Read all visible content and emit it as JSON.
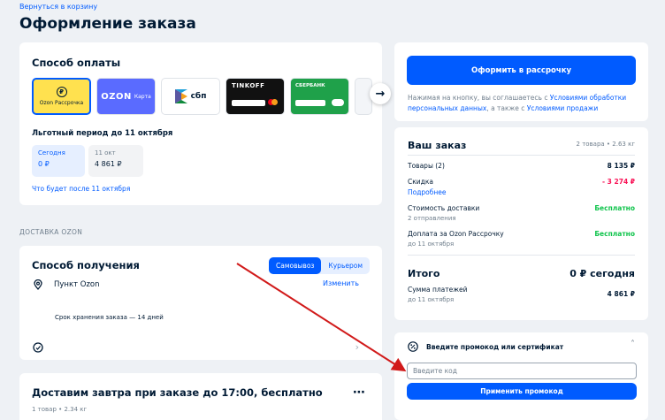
{
  "header": {
    "back_link": "Вернуться в корзину",
    "title": "Оформление заказа"
  },
  "payment": {
    "title": "Способ оплаты",
    "methods": [
      {
        "label": "Ozon Рассрочка"
      },
      {
        "brand": "OZON",
        "label": "Карта"
      },
      {
        "label": "сбп"
      },
      {
        "label": "TINKOFF"
      },
      {
        "label": "СБЕРБАНК"
      }
    ],
    "grace_period": "Льготный период до 11 октября",
    "schedule": [
      {
        "label": "Сегодня",
        "value": "0 ₽"
      },
      {
        "label": "11 окт",
        "value": "4 861 ₽"
      }
    ],
    "after_link": "Что будет после 11 октября"
  },
  "section_label": "ДОСТАВКА OZON",
  "pickup": {
    "title": "Способ получения",
    "toggle": [
      "Самовывоз",
      "Курьером"
    ],
    "point": "Пункт Ozon",
    "change": "Изменить",
    "storage": "Срок хранения заказа — 14 дней"
  },
  "delivery": {
    "title": "Доставим завтра при заказе до 17:00, бесплатно",
    "sub": "1 товар • 2.34 кг"
  },
  "checkout": {
    "button": "Оформить в рассрочку",
    "note_prefix": "Нажимая на кнопку, вы соглашаетесь с ",
    "note_link1": "Условиями обработки персональных данных",
    "note_mid": ", а также с ",
    "note_link2": "Условиями продажи"
  },
  "order": {
    "title": "Ваш заказ",
    "meta": "2 товара • 2.63 кг",
    "goods_label": "Товары (2)",
    "goods_value": "8 135 ₽",
    "discount_label": "Скидка",
    "discount_value": "- 3 274 ₽",
    "details_link": "Подробнее",
    "shipping_label": "Стоимость доставки",
    "shipping_sub": "2 отправления",
    "shipping_value": "Бесплатно",
    "fee_label": "Доплата за Ozon Рассрочку",
    "fee_sub": "до 11 октября",
    "fee_value": "Бесплатно",
    "total_label": "Итого",
    "total_value": "0 ₽ сегодня",
    "sum_label": "Сумма платежей",
    "sum_sub": "до 11 октября",
    "sum_value": "4 861 ₽"
  },
  "promo": {
    "title": "Введите промокод или сертификат",
    "placeholder": "Введите код",
    "button": "Применить промокод"
  },
  "colors": {
    "accent": "#005bff",
    "discount": "#f91155",
    "free": "#10c44c",
    "arrow": "#d11a1a"
  }
}
